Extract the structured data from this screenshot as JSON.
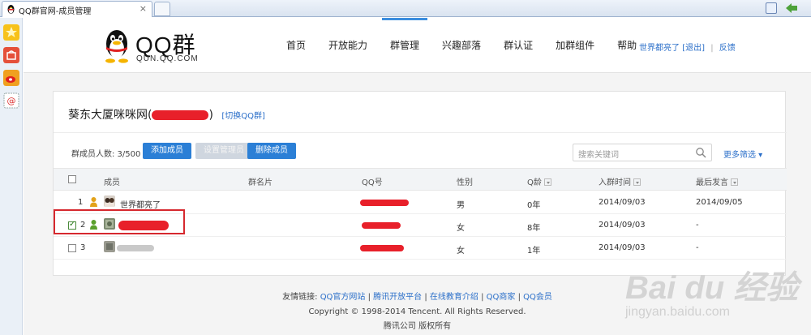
{
  "browser": {
    "tab_title": "QQ群官网-成员管理",
    "tab_close": "×"
  },
  "header": {
    "logo_main": "QQ群",
    "logo_sub": "QUN.QQ.COM",
    "nav": [
      "首页",
      "开放能力",
      "群管理",
      "兴趣部落",
      "群认证",
      "加群组件",
      "帮助"
    ],
    "active_nav": "群管理",
    "user_name": "世界都亮了",
    "logout": "[退出]",
    "feedback": "反馈",
    "separator": "|"
  },
  "panel": {
    "group_name": "葵东大厦咪咪网(",
    "group_name_close": ")",
    "switch_group": "[切换QQ群]",
    "member_count": "群成员人数: 3/500",
    "add_member": "添加成员",
    "set_admin": "设置管理员",
    "delete_member": "删除成员",
    "search_placeholder": "搜索关键词",
    "more_filter": "更多筛选 ▾"
  },
  "table": {
    "headers": {
      "member": "成员",
      "card": "群名片",
      "qq": "QQ号",
      "gender": "性别",
      "q_age": "Q龄",
      "join_time": "入群时间",
      "last_post": "最后发言"
    },
    "rows": [
      {
        "index": "1",
        "name": "世界都亮了",
        "gender": "男",
        "q_age": "0年",
        "join_time": "2014/09/03",
        "last_post": "2014/09/05",
        "checked": false
      },
      {
        "index": "2",
        "name": "",
        "gender": "女",
        "q_age": "8年",
        "join_time": "2014/09/03",
        "last_post": "-",
        "checked": true
      },
      {
        "index": "3",
        "name": "",
        "gender": "女",
        "q_age": "1年",
        "join_time": "2014/09/03",
        "last_post": "-",
        "checked": false
      }
    ]
  },
  "footer": {
    "links_label": "友情链接:",
    "links": [
      "QQ官方网站",
      "腾讯开放平台",
      "在线教育介绍",
      "QQ商家",
      "QQ会员"
    ],
    "copyright": "Copyright © 1998-2014 Tencent. All Rights Reserved.",
    "company": "腾讯公司 版权所有"
  },
  "watermark": {
    "main": "Bai du 经验",
    "sub": "jingyan.baidu.com"
  },
  "colors": {
    "accent": "#2b7fd6",
    "link": "#2b6fc9",
    "redaction": "#e8202a",
    "highlight_box": "#d6282e"
  }
}
